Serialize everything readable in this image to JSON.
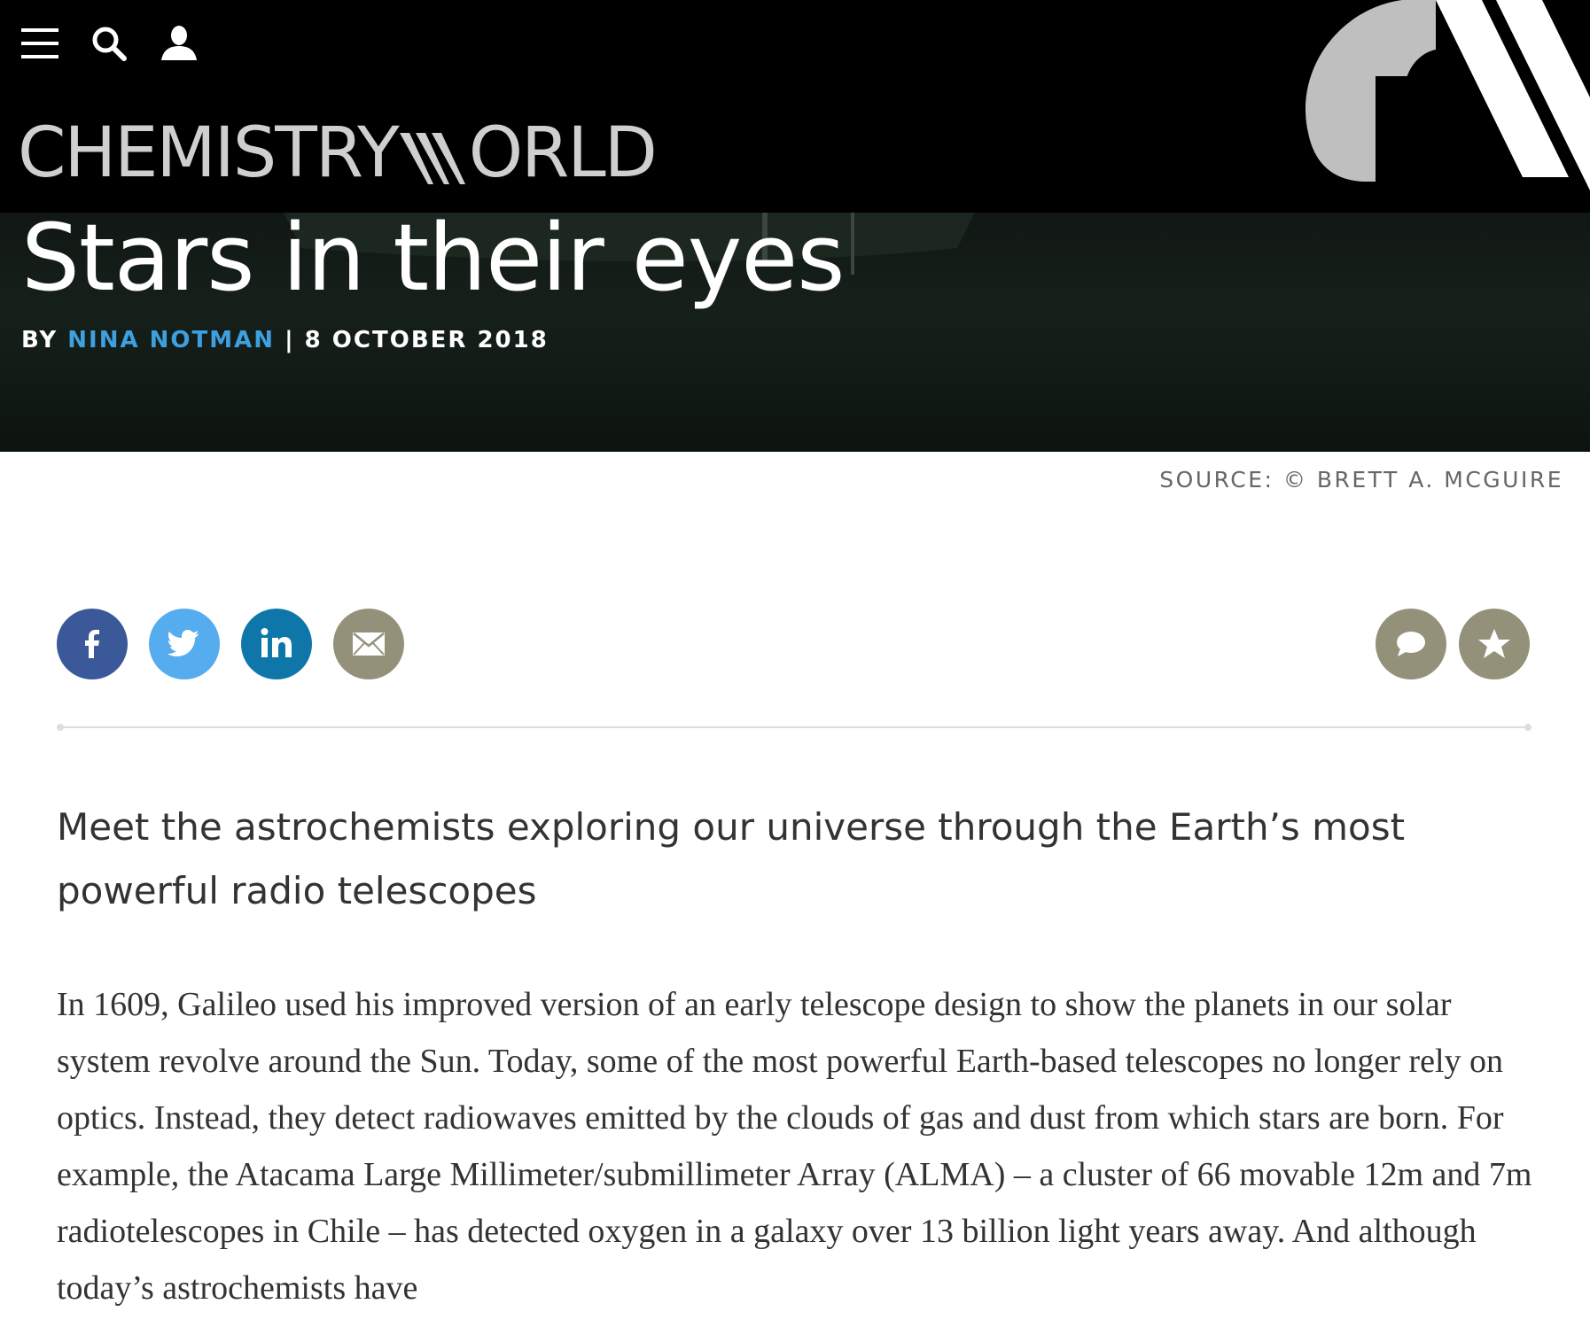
{
  "header": {
    "brand_part1": "CHEMISTRY",
    "brand_part2": "ORLD",
    "icons": [
      "menu-icon",
      "search-icon",
      "user-icon"
    ]
  },
  "hero": {
    "title": "Stars in their eyes",
    "by_label": "BY",
    "author": "NINA NOTMAN",
    "separator": "|",
    "date": "8 OCTOBER 2018"
  },
  "credit": "SOURCE: © BRETT A. MCGUIRE",
  "share": {
    "buttons": [
      {
        "name": "facebook",
        "color": "#3b5998"
      },
      {
        "name": "twitter",
        "color": "#55acee"
      },
      {
        "name": "linkedin",
        "color": "#0e76a8"
      },
      {
        "name": "email",
        "color": "#94917a"
      }
    ],
    "actions": [
      {
        "name": "comment",
        "color": "#94917a"
      },
      {
        "name": "favourite",
        "color": "#94917a"
      }
    ]
  },
  "article": {
    "standfirst": "Meet the astrochemists exploring our universe through the Earth’s most powerful radio telescopes",
    "paragraph": "In 1609, Galileo used his improved version of an early telescope design to show the planets in our solar system revolve around the Sun. Today, some of the most powerful Earth-based telescopes no longer rely on optics. Instead, they detect radiowaves emitted by the clouds of gas and dust from which stars are born. For example, the Atacama Large Millimeter/submillimeter Array (ALMA) – a cluster of 66 movable 12m and 7m radiotelescopes in Chile – has detected oxygen in a galaxy over 13 billion light years away. And although today’s astrochemists have"
  }
}
